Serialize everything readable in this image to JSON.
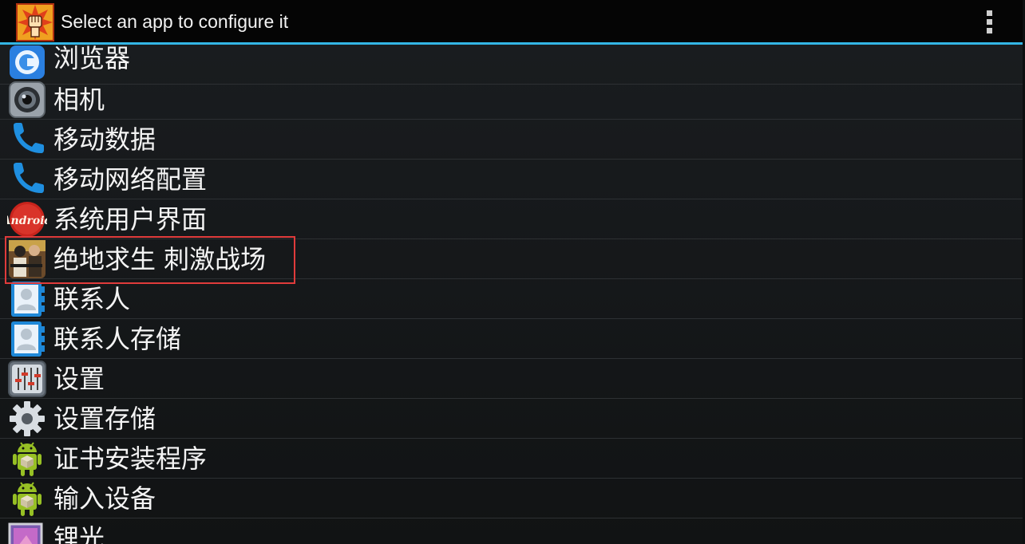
{
  "header": {
    "title": "Select an app to configure it",
    "app_icon": "fist-logo-icon",
    "overflow_icon": "overflow-menu-icon",
    "accent_color": "#33b5e5"
  },
  "apps": [
    {
      "label": "浏览器",
      "icon": "browser-icon"
    },
    {
      "label": "相机",
      "icon": "camera-icon"
    },
    {
      "label": "移动数据",
      "icon": "phone-icon"
    },
    {
      "label": "移动网络配置",
      "icon": "phone-icon"
    },
    {
      "label": "系统用户界面",
      "icon": "android-kitkat-icon"
    },
    {
      "label": "绝地求生 刺激战场",
      "icon": "pubg-game-icon",
      "highlighted": true
    },
    {
      "label": "联系人",
      "icon": "contacts-icon"
    },
    {
      "label": "联系人存储",
      "icon": "contacts-icon"
    },
    {
      "label": "设置",
      "icon": "settings-sliders-icon"
    },
    {
      "label": "设置存储",
      "icon": "gear-icon"
    },
    {
      "label": "证书安装程序",
      "icon": "android-robot-icon"
    },
    {
      "label": "输入设备",
      "icon": "android-robot-icon"
    },
    {
      "label": "锂光",
      "icon": "gallery-icon"
    }
  ],
  "highlight_color": "#e03b3b"
}
